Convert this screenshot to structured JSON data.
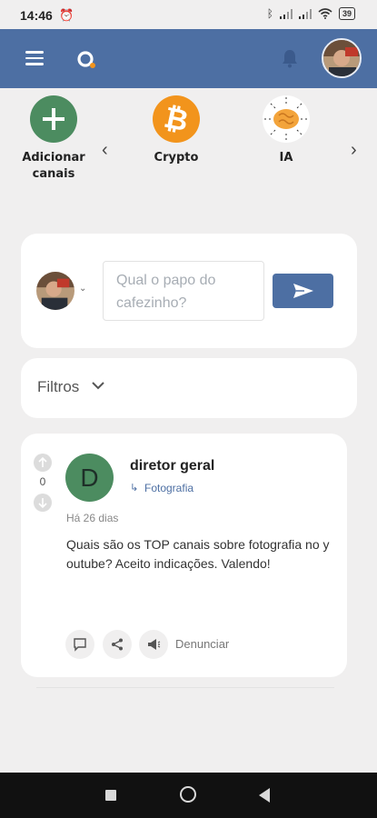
{
  "status_bar": {
    "time": "14:46",
    "battery": "39"
  },
  "channels": {
    "items": [
      {
        "label_line1": "Adicionar",
        "label_line2": "canais",
        "icon": "plus-icon",
        "color": "#4c8c60"
      },
      {
        "label_line1": "Crypto",
        "label_line2": "",
        "icon": "bitcoin-icon",
        "color": "#f2941c"
      },
      {
        "label_line1": "IA",
        "label_line2": "",
        "icon": "brain-icon",
        "color": "#f3a43b"
      }
    ]
  },
  "composer": {
    "placeholder": "Qual o papo do cafezinho?"
  },
  "filters": {
    "label": "Filtros"
  },
  "post": {
    "votes": "0",
    "avatar_letter": "D",
    "author": "diretor geral",
    "channel": "Fotografia",
    "time": "Há 26 dias",
    "body": "Quais são os TOP canais sobre fotografia no youtube? Aceito indicações. Valendo!",
    "report_label": "Denunciar"
  },
  "colors": {
    "primary": "#4d6fa3",
    "background": "#f0efef",
    "green": "#4c8c60"
  }
}
